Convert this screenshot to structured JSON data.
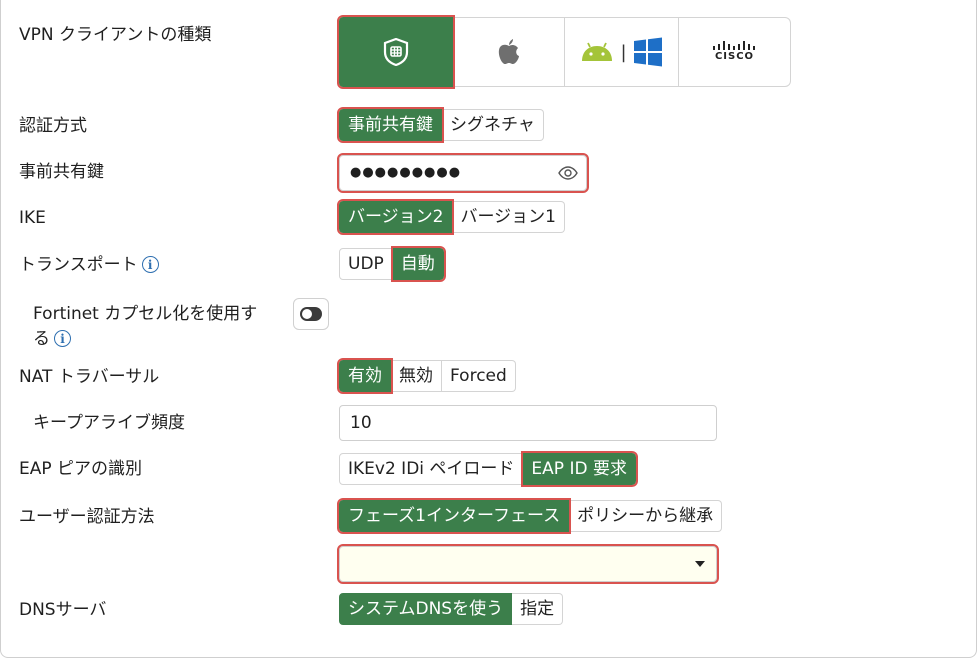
{
  "labels": {
    "vpn_type": "VPN クライアントの種類",
    "auth_method": "認証方式",
    "psk": "事前共有鍵",
    "ike": "IKE",
    "transport": "トランスポート",
    "fortinet_encap_line1": "Fortinet カプセル化を使用す",
    "fortinet_encap_line2": "る",
    "nat_traversal": "NAT トラバーサル",
    "keepalive": "キープアライブ頻度",
    "eap_peer": "EAP ピアの識別",
    "user_auth": "ユーザー認証方法",
    "dns_server": "DNSサーバ"
  },
  "vpn_types": [
    {
      "icon": "fortinet-shield-icon",
      "selected": true
    },
    {
      "icon": "apple-icon",
      "selected": false
    },
    {
      "icon": "android-windows-icon",
      "separator": "|",
      "selected": false
    },
    {
      "icon": "cisco-icon",
      "text": "CISCO",
      "selected": false
    }
  ],
  "auth_method": {
    "options": [
      "事前共有鍵",
      "シグネチャ"
    ],
    "selected": 0
  },
  "psk": {
    "value": "●●●●●●●●●",
    "icon": "eye-icon"
  },
  "ike": {
    "options": [
      "バージョン2",
      "バージョン1"
    ],
    "selected": 0
  },
  "transport": {
    "options": [
      "UDP",
      "自動"
    ],
    "selected": 1,
    "info_icon": "i"
  },
  "fortinet_encap": {
    "on": false,
    "info_icon": "i"
  },
  "nat_traversal": {
    "options": [
      "有効",
      "無効",
      "Forced"
    ],
    "selected": 0
  },
  "keepalive": {
    "value": "10"
  },
  "eap_peer": {
    "options": [
      "IKEv2 IDi ペイロード",
      "EAP ID 要求"
    ],
    "selected": 1
  },
  "user_auth": {
    "options": [
      "フェーズ1インターフェース",
      "ポリシーから継承"
    ],
    "selected": 0,
    "select_value": ""
  },
  "dns_server": {
    "options": [
      "システムDNSを使う",
      "指定"
    ],
    "selected": 0
  },
  "colors": {
    "accent": "#3c7f4b",
    "highlight": "#d9534f",
    "info": "#2e6fb0"
  }
}
